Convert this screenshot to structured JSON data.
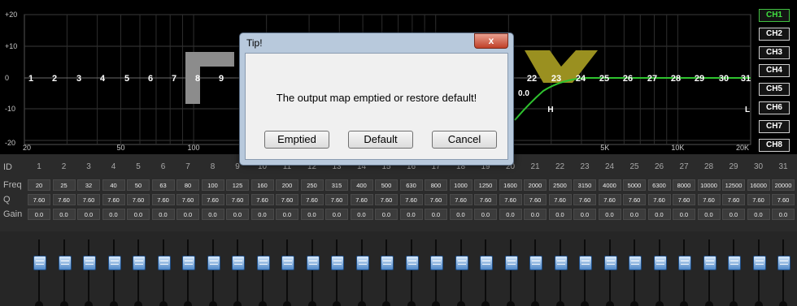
{
  "graph": {
    "y_ticks": [
      "+20",
      "+10",
      "0",
      "-10",
      "-20"
    ],
    "x_ticks": [
      "20",
      "50",
      "100",
      "5K",
      "10K",
      "20K"
    ],
    "band_markers_left": [
      "1",
      "2",
      "3",
      "4",
      "5",
      "6",
      "7",
      "8",
      "9"
    ],
    "band_markers_right": [
      "22",
      "23",
      "24",
      "25",
      "26",
      "27",
      "28",
      "29",
      "30",
      "31"
    ],
    "gain_readout": "0.0",
    "marker_h": "H",
    "marker_l": "L",
    "curve_color": "#2fc22f"
  },
  "channels": [
    "CH1",
    "CH2",
    "CH3",
    "CH4",
    "CH5",
    "CH6",
    "CH7",
    "CH8"
  ],
  "active_channel": "CH1",
  "table": {
    "labels": {
      "id": "ID",
      "freq": "Freq",
      "q": "Q",
      "gain": "Gain"
    },
    "ids": [
      "1",
      "2",
      "3",
      "4",
      "5",
      "6",
      "7",
      "8",
      "9",
      "10",
      "11",
      "12",
      "13",
      "14",
      "15",
      "16",
      "17",
      "18",
      "19",
      "20",
      "21",
      "22",
      "23",
      "24",
      "25",
      "26",
      "27",
      "28",
      "29",
      "30",
      "31"
    ],
    "freqs": [
      "20",
      "25",
      "32",
      "40",
      "50",
      "63",
      "80",
      "100",
      "125",
      "160",
      "200",
      "250",
      "315",
      "400",
      "500",
      "630",
      "800",
      "1000",
      "1250",
      "1600",
      "2000",
      "2500",
      "3150",
      "4000",
      "5000",
      "6300",
      "8000",
      "10000",
      "12500",
      "16000",
      "20000"
    ],
    "q_value": "7.60",
    "gain_value": "0.0"
  },
  "dialog": {
    "title": "Tip!",
    "close_label": "x",
    "message": "The output map emptied or restore default!",
    "buttons": [
      "Emptied",
      "Default",
      "Cancel"
    ]
  }
}
